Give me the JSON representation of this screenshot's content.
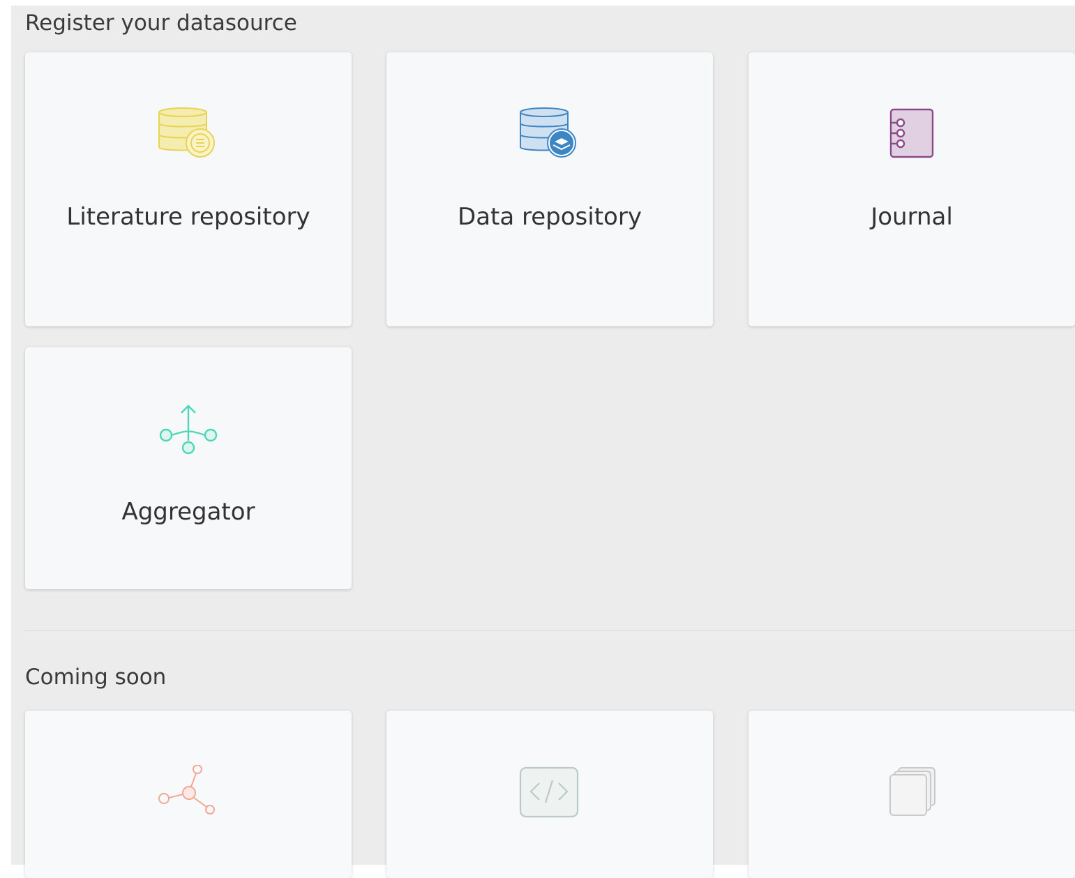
{
  "register": {
    "title": "Register your datasource",
    "cards": [
      {
        "label": "Literature repository",
        "icon": "literature-repository-icon",
        "color": "#e8d352"
      },
      {
        "label": "Data repository",
        "icon": "data-repository-icon",
        "color": "#3d86c6"
      },
      {
        "label": "Journal",
        "icon": "journal-icon",
        "color": "#8a4a8a"
      },
      {
        "label": "Aggregator",
        "icon": "aggregator-icon",
        "color": "#4fd6b8"
      }
    ]
  },
  "coming_soon": {
    "title": "Coming soon",
    "cards": [
      {
        "icon": "network-node-icon",
        "color": "#f2a896"
      },
      {
        "icon": "code-icon",
        "color": "#bcc9c6"
      },
      {
        "icon": "stacked-documents-icon",
        "color": "#c9c9c9"
      }
    ]
  }
}
